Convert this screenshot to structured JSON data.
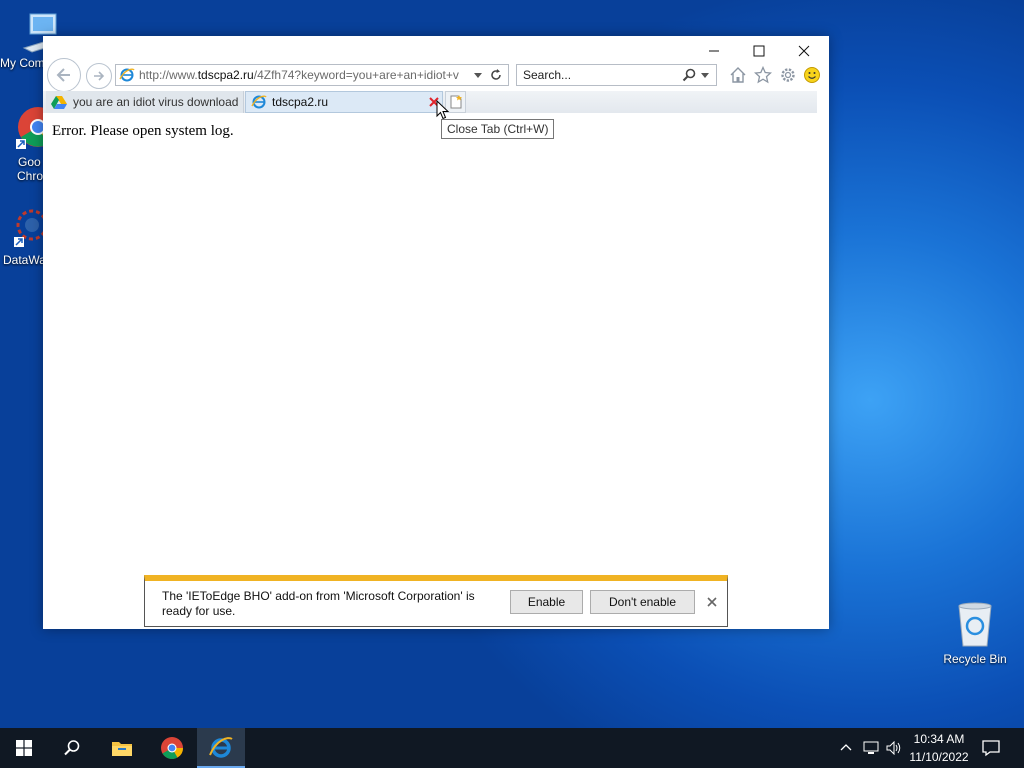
{
  "desktop": {
    "icons": [
      {
        "label": "My Com"
      },
      {
        "label_line1": "Goo",
        "label_line2": "Chro"
      },
      {
        "label": "DataWa"
      },
      {
        "label": "Recycle Bin"
      }
    ]
  },
  "browser": {
    "address": {
      "url_prefix": "http://www.",
      "url_domain": "tdscpa2.ru",
      "url_rest": "/4Zfh74?keyword=you+are+an+idiot+v"
    },
    "search": {
      "placeholder": "Search..."
    },
    "tabs": [
      {
        "label": "you are an idiot virus download"
      },
      {
        "label": "tdscpa2.ru"
      }
    ],
    "tooltip": "Close Tab (Ctrl+W)",
    "page_text": "Error. Please open system log."
  },
  "notification": {
    "message": "The 'IEToEdge BHO' add-on from 'Microsoft Corporation' is ready for use.",
    "enable_label": "Enable",
    "dont_enable_label": "Don't enable"
  },
  "taskbar": {
    "time": "10:34 AM",
    "date": "11/10/2022"
  },
  "colors": {
    "notification_accent": "#f0b323",
    "taskbar_bg": "#101823",
    "desktop_bg": "#0b4fb5"
  }
}
